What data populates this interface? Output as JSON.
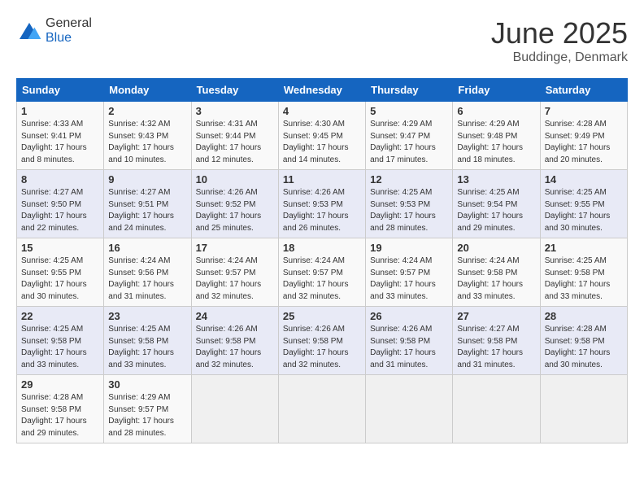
{
  "logo": {
    "general": "General",
    "blue": "Blue"
  },
  "header": {
    "month": "June 2025",
    "location": "Buddinge, Denmark"
  },
  "days_of_week": [
    "Sunday",
    "Monday",
    "Tuesday",
    "Wednesday",
    "Thursday",
    "Friday",
    "Saturday"
  ],
  "weeks": [
    [
      {
        "day": "1",
        "info": "Sunrise: 4:33 AM\nSunset: 9:41 PM\nDaylight: 17 hours\nand 8 minutes."
      },
      {
        "day": "2",
        "info": "Sunrise: 4:32 AM\nSunset: 9:43 PM\nDaylight: 17 hours\nand 10 minutes."
      },
      {
        "day": "3",
        "info": "Sunrise: 4:31 AM\nSunset: 9:44 PM\nDaylight: 17 hours\nand 12 minutes."
      },
      {
        "day": "4",
        "info": "Sunrise: 4:30 AM\nSunset: 9:45 PM\nDaylight: 17 hours\nand 14 minutes."
      },
      {
        "day": "5",
        "info": "Sunrise: 4:29 AM\nSunset: 9:47 PM\nDaylight: 17 hours\nand 17 minutes."
      },
      {
        "day": "6",
        "info": "Sunrise: 4:29 AM\nSunset: 9:48 PM\nDaylight: 17 hours\nand 18 minutes."
      },
      {
        "day": "7",
        "info": "Sunrise: 4:28 AM\nSunset: 9:49 PM\nDaylight: 17 hours\nand 20 minutes."
      }
    ],
    [
      {
        "day": "8",
        "info": "Sunrise: 4:27 AM\nSunset: 9:50 PM\nDaylight: 17 hours\nand 22 minutes."
      },
      {
        "day": "9",
        "info": "Sunrise: 4:27 AM\nSunset: 9:51 PM\nDaylight: 17 hours\nand 24 minutes."
      },
      {
        "day": "10",
        "info": "Sunrise: 4:26 AM\nSunset: 9:52 PM\nDaylight: 17 hours\nand 25 minutes."
      },
      {
        "day": "11",
        "info": "Sunrise: 4:26 AM\nSunset: 9:53 PM\nDaylight: 17 hours\nand 26 minutes."
      },
      {
        "day": "12",
        "info": "Sunrise: 4:25 AM\nSunset: 9:53 PM\nDaylight: 17 hours\nand 28 minutes."
      },
      {
        "day": "13",
        "info": "Sunrise: 4:25 AM\nSunset: 9:54 PM\nDaylight: 17 hours\nand 29 minutes."
      },
      {
        "day": "14",
        "info": "Sunrise: 4:25 AM\nSunset: 9:55 PM\nDaylight: 17 hours\nand 30 minutes."
      }
    ],
    [
      {
        "day": "15",
        "info": "Sunrise: 4:25 AM\nSunset: 9:55 PM\nDaylight: 17 hours\nand 30 minutes."
      },
      {
        "day": "16",
        "info": "Sunrise: 4:24 AM\nSunset: 9:56 PM\nDaylight: 17 hours\nand 31 minutes."
      },
      {
        "day": "17",
        "info": "Sunrise: 4:24 AM\nSunset: 9:57 PM\nDaylight: 17 hours\nand 32 minutes."
      },
      {
        "day": "18",
        "info": "Sunrise: 4:24 AM\nSunset: 9:57 PM\nDaylight: 17 hours\nand 32 minutes."
      },
      {
        "day": "19",
        "info": "Sunrise: 4:24 AM\nSunset: 9:57 PM\nDaylight: 17 hours\nand 33 minutes."
      },
      {
        "day": "20",
        "info": "Sunrise: 4:24 AM\nSunset: 9:58 PM\nDaylight: 17 hours\nand 33 minutes."
      },
      {
        "day": "21",
        "info": "Sunrise: 4:25 AM\nSunset: 9:58 PM\nDaylight: 17 hours\nand 33 minutes."
      }
    ],
    [
      {
        "day": "22",
        "info": "Sunrise: 4:25 AM\nSunset: 9:58 PM\nDaylight: 17 hours\nand 33 minutes."
      },
      {
        "day": "23",
        "info": "Sunrise: 4:25 AM\nSunset: 9:58 PM\nDaylight: 17 hours\nand 33 minutes."
      },
      {
        "day": "24",
        "info": "Sunrise: 4:26 AM\nSunset: 9:58 PM\nDaylight: 17 hours\nand 32 minutes."
      },
      {
        "day": "25",
        "info": "Sunrise: 4:26 AM\nSunset: 9:58 PM\nDaylight: 17 hours\nand 32 minutes."
      },
      {
        "day": "26",
        "info": "Sunrise: 4:26 AM\nSunset: 9:58 PM\nDaylight: 17 hours\nand 31 minutes."
      },
      {
        "day": "27",
        "info": "Sunrise: 4:27 AM\nSunset: 9:58 PM\nDaylight: 17 hours\nand 31 minutes."
      },
      {
        "day": "28",
        "info": "Sunrise: 4:28 AM\nSunset: 9:58 PM\nDaylight: 17 hours\nand 30 minutes."
      }
    ],
    [
      {
        "day": "29",
        "info": "Sunrise: 4:28 AM\nSunset: 9:58 PM\nDaylight: 17 hours\nand 29 minutes."
      },
      {
        "day": "30",
        "info": "Sunrise: 4:29 AM\nSunset: 9:57 PM\nDaylight: 17 hours\nand 28 minutes."
      },
      {
        "day": "",
        "info": ""
      },
      {
        "day": "",
        "info": ""
      },
      {
        "day": "",
        "info": ""
      },
      {
        "day": "",
        "info": ""
      },
      {
        "day": "",
        "info": ""
      }
    ]
  ]
}
